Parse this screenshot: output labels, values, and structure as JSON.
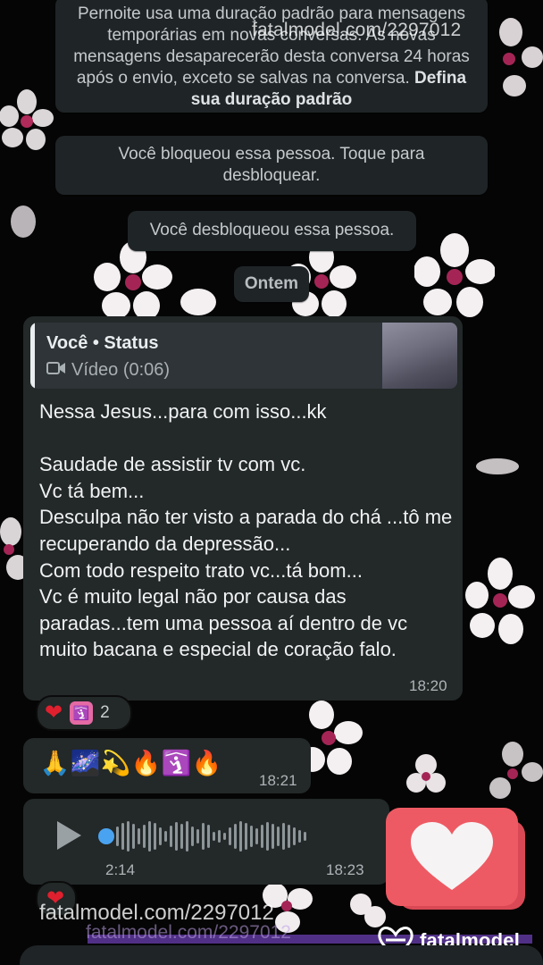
{
  "system_messages": {
    "temporary_info": "Pernoite usa uma duração padrão para mensagens temporárias em novas conversas. As novas mensagens desaparecerão desta conversa 24 horas após o envio, exceto se salvas na conversa.",
    "temporary_link": "Defina sua duração padrão",
    "blocked": "Você bloqueou essa pessoa. Toque para desbloquear.",
    "unblocked": "Você desbloqueou essa pessoa.",
    "date_divider": "Ontem"
  },
  "watermark": {
    "top": "fatalmodel.com/2297012",
    "bottom": "fatalmodel.com/2297012",
    "brand": "fatalmodel"
  },
  "status_message": {
    "quote_author": "Você • Status",
    "quote_type": "Vídeo (0:06)",
    "text": "Nessa Jesus...para com isso...kk\n\nSaudade de assistir tv com vc.\nVc tá bem...\nDesculpa não ter visto a parada do chá ...tô me recuperando da depressão...\nCom todo respeito trato vc...tá bom...\nVc é muito legal não por causa das paradas...tem uma pessoa aí dentro de vc muito bacana e especial de coração falo.",
    "time": "18:20",
    "reaction_count": "2"
  },
  "emoji_message": {
    "emojis": [
      "🙏",
      "🌌",
      "💫",
      "🔥",
      "🛐",
      "🔥"
    ],
    "time": "18:21"
  },
  "audio_message": {
    "duration": "2:14",
    "time": "18:23",
    "progress": 0.0
  },
  "icons": [
    "play-icon",
    "video-icon",
    "heart-icon",
    "place-of-worship-icon",
    "fatalmodel-logo-icon"
  ],
  "colors": {
    "bubble": "#232828",
    "system_bubble": "#1f2427",
    "audio_dot": "#4aa3f0",
    "badge": "#ee5a63",
    "brand_bar": "#6a3fb1"
  }
}
